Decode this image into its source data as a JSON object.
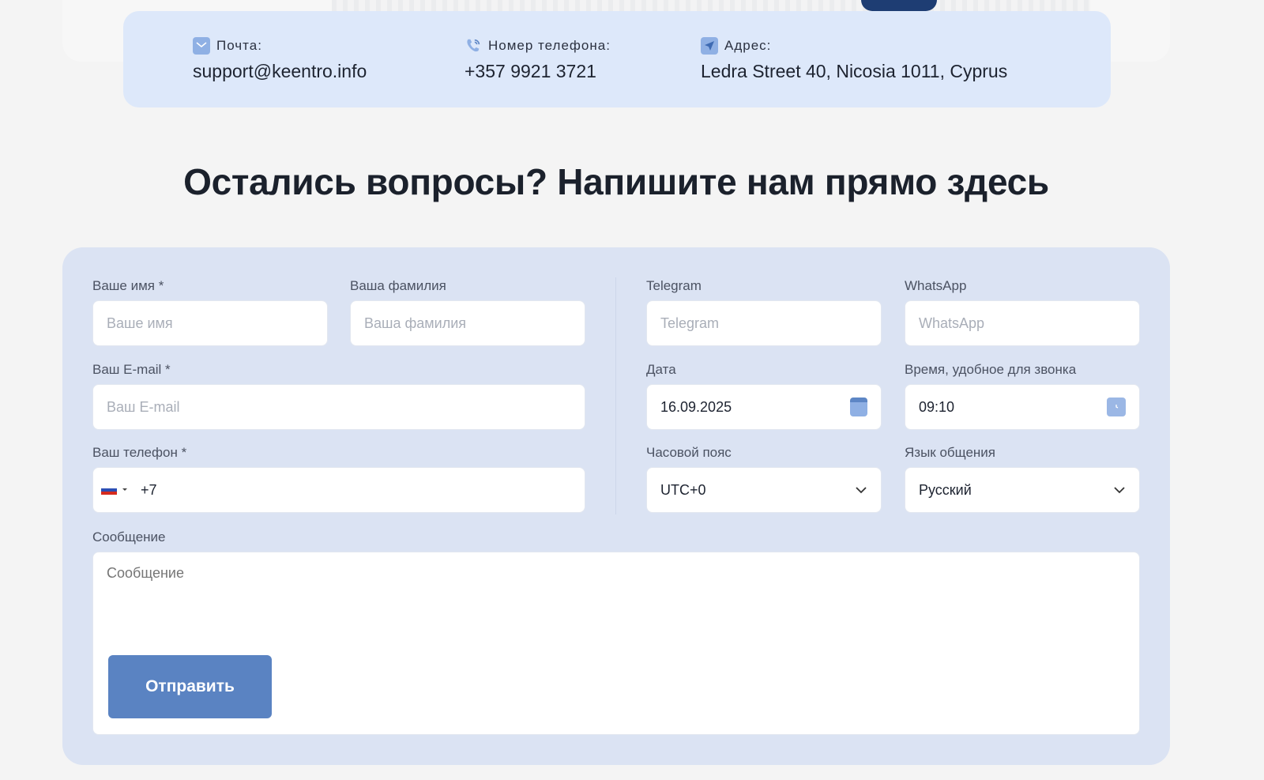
{
  "contacts": {
    "mail": {
      "label": "Почта:",
      "value": "support@keentro.info"
    },
    "phone": {
      "label": "Номер телефона:",
      "value": "+357 9921 3721"
    },
    "address": {
      "label": "Адрес:",
      "value": "Ledra Street 40, Nicosia 1011, Cyprus"
    }
  },
  "section_title": "Остались вопросы? Напишите нам прямо здесь",
  "form": {
    "first_name": {
      "label": "Ваше имя *",
      "placeholder": "Ваше имя"
    },
    "last_name": {
      "label": "Ваша фамилия",
      "placeholder": "Ваша фамилия"
    },
    "email": {
      "label": "Ваш E-mail *",
      "placeholder": "Ваш E-mail"
    },
    "phone": {
      "label": "Ваш телефон *",
      "value": "+7"
    },
    "telegram": {
      "label": "Telegram",
      "placeholder": "Telegram"
    },
    "whatsapp": {
      "label": "WhatsApp",
      "placeholder": "WhatsApp"
    },
    "date": {
      "label": "Дата",
      "value": "16.09.2025"
    },
    "time": {
      "label": "Время, удобное для звонка",
      "value": "09:10"
    },
    "timezone": {
      "label": "Часовой пояс",
      "value": "UTC+0"
    },
    "language": {
      "label": "Язык общения",
      "value": "Русский"
    },
    "message": {
      "label": "Сообщение",
      "placeholder": "Сообщение"
    },
    "submit_label": "Отправить"
  },
  "colors": {
    "accent": "#5a83c2",
    "contact_bar": "#dde8fa",
    "form_bg": "#dbe3f3",
    "icon": "#8fb0e4"
  },
  "icons": {
    "mail": "mail-icon",
    "phone": "phone-icon",
    "address": "location-arrow-icon",
    "date": "calendar-icon",
    "time": "clock-icon",
    "dropdown": "chevron-down-icon",
    "flag": "russia-flag-icon"
  }
}
